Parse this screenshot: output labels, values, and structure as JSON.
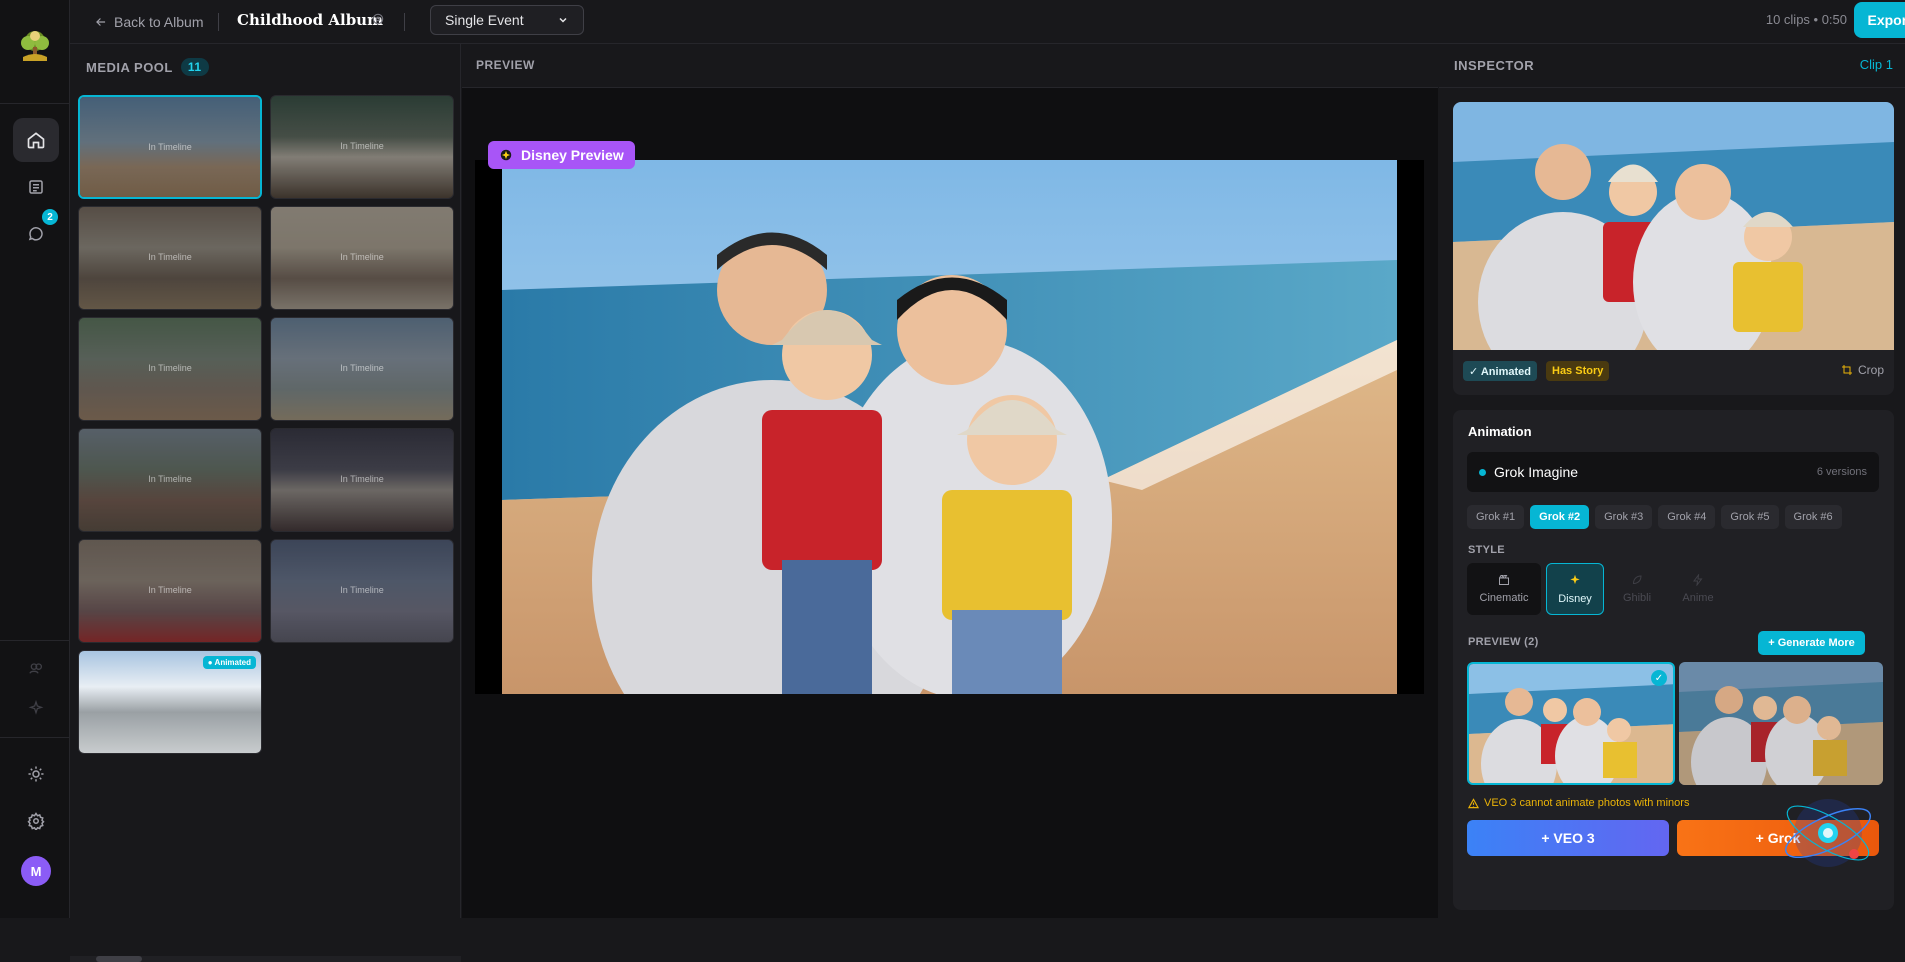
{
  "topbar": {
    "back_label": "Back to Album",
    "album_title": "Childhood Album",
    "event_type": "Single Event",
    "clips_info": "10 clips • 0:50",
    "export_label": "Export Film"
  },
  "rail": {
    "messages_badge": "2",
    "avatar_initial": "M"
  },
  "media_pool": {
    "title": "MEDIA POOL",
    "count": "11",
    "in_timeline_label": "In Timeline",
    "animated_label": "● Animated"
  },
  "preview": {
    "title": "PREVIEW",
    "style_pill": "Disney Preview"
  },
  "inspector": {
    "title": "INSPECTOR",
    "clip": "Clip 1",
    "tags": [
      "✓ Animated",
      "Has Story"
    ],
    "crop_label": "Crop",
    "animation_title": "Animation",
    "engine": "Grok Imagine",
    "versions_count": "6 versions",
    "versions": [
      "Grok #1",
      "Grok #2",
      "Grok #3",
      "Grok #4",
      "Grok #5",
      "Grok #6"
    ],
    "selected_version": "Grok #2",
    "style_label": "STYLE",
    "styles": [
      "Cinematic",
      "Disney",
      "Ghibli",
      "Anime"
    ],
    "selected_style": "Disney",
    "preview_label": "PREVIEW (2)",
    "generate_more": "+ Generate More",
    "warning": "VEO 3 cannot animate photos with minors",
    "veo_button": "+ VEO 3",
    "grok_button": "+ Grok"
  },
  "colors": {
    "accent": "#06b6d4",
    "disney_pill": "#a855f7",
    "warning": "#eab308",
    "veo_gradient": "#3b82f6",
    "grok_gradient": "#f97316"
  }
}
